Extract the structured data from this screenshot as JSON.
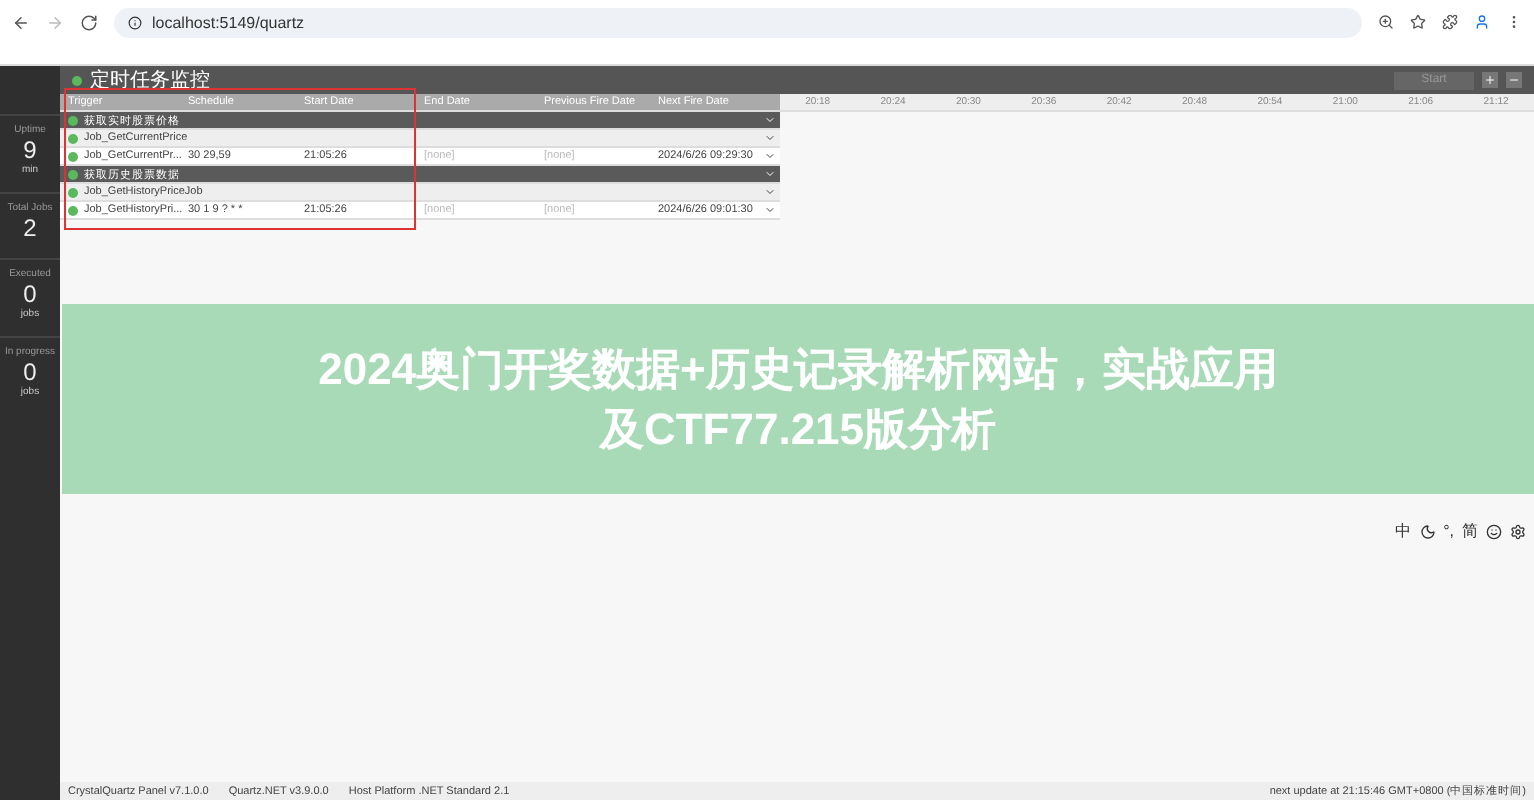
{
  "browser": {
    "url": "localhost:5149/quartz"
  },
  "sidebar": {
    "stats": [
      {
        "label": "Uptime",
        "value": "9",
        "unit": "min"
      },
      {
        "label": "Total Jobs",
        "value": "2"
      },
      {
        "label": "Executed",
        "value": "0",
        "unit": "jobs"
      },
      {
        "label": "In progress",
        "value": "0",
        "unit": "jobs"
      }
    ]
  },
  "header": {
    "title": "定时任务监控",
    "start_button": "Start"
  },
  "table": {
    "columns": [
      "Trigger",
      "Schedule",
      "Start Date",
      "End Date",
      "Previous Fire Date",
      "Next Fire Date"
    ],
    "timeline_ticks": [
      "20:18",
      "20:24",
      "20:30",
      "20:36",
      "20:42",
      "20:48",
      "20:54",
      "21:00",
      "21:06",
      "21:12"
    ],
    "groups": [
      {
        "name": "获取实时股票价格",
        "jobs": [
          {
            "name": "Job_GetCurrentPrice",
            "triggers": [
              {
                "name": "Job_GetCurrentPr...",
                "schedule": "30 29,59",
                "start": "21:05:26",
                "end": "[none]",
                "previous": "[none]",
                "next": "2024/6/26 09:29:30"
              }
            ]
          }
        ]
      },
      {
        "name": "获取历史股票数据",
        "jobs": [
          {
            "name": "Job_GetHistoryPriceJob",
            "triggers": [
              {
                "name": "Job_GetHistoryPri...",
                "schedule": "30 1 9 ? * *",
                "start": "21:05:26",
                "end": "[none]",
                "previous": "[none]",
                "next": "2024/6/26 09:01:30"
              }
            ]
          }
        ]
      }
    ]
  },
  "ime_toolbar": [
    "中",
    "°,",
    "简"
  ],
  "banner": {
    "lines": [
      "2024奥门开奖数据+历史记录解析网站，实战应用",
      "及CTF77.215版分析"
    ]
  },
  "footer": {
    "items": [
      "CrystalQuartz Panel v7.1.0.0",
      "Quartz.NET v3.9.0.0",
      "Host Platform .NET Standard 2.1"
    ],
    "update": "next update at 21:15:46 GMT+0800 (中国标准时间)"
  }
}
